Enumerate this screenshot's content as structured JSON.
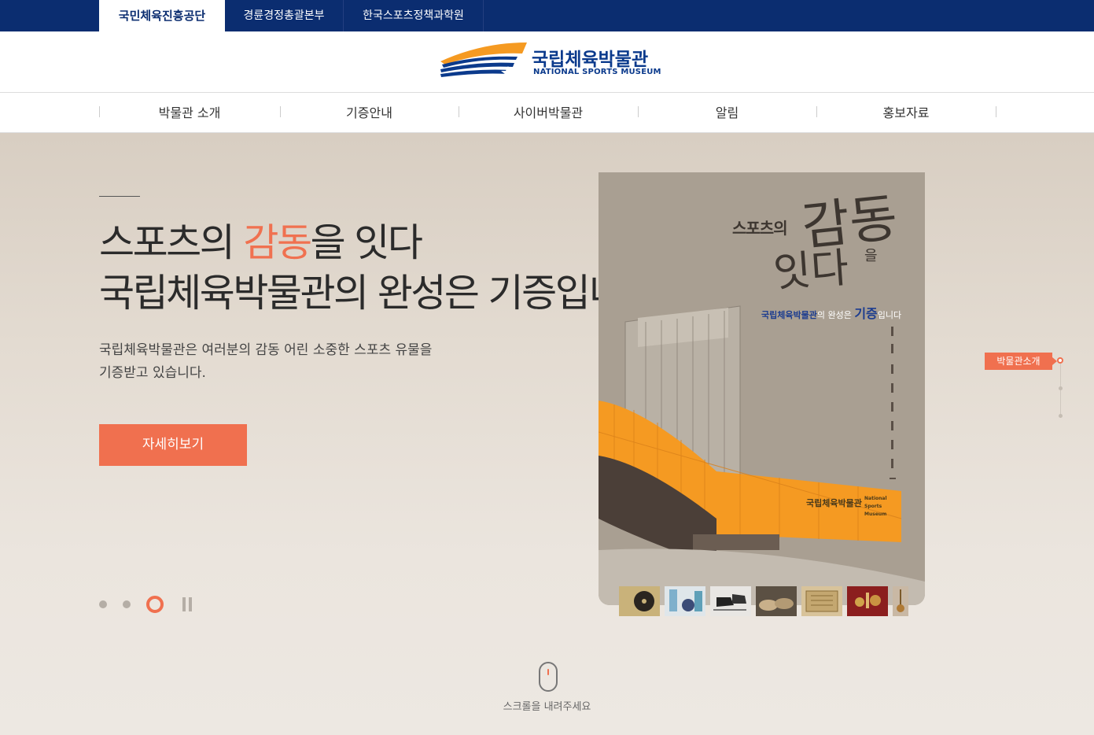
{
  "top_tabs": [
    {
      "label": "국민체육진흥공단",
      "active": true
    },
    {
      "label": "경륜경정총괄본부",
      "active": false
    },
    {
      "label": "한국스포츠정책과학원",
      "active": false
    }
  ],
  "logo": {
    "korean": "국립체육박물관",
    "english": "NATIONAL SPORTS MUSEUM"
  },
  "nav": [
    "박물관 소개",
    "기증안내",
    "사이버박물관",
    "알림",
    "홍보자료"
  ],
  "hero": {
    "title_line1_a": "스포츠의 ",
    "title_line1_highlight": "감동",
    "title_line1_b": "을 잇다",
    "title_line2": "국립체육박물관의 완성은 기증입니다.",
    "desc_line1": "국립체육박물관은 여러분의 감동 어린 소중한 스포츠 유물을",
    "desc_line2": "기증받고 있습니다.",
    "button": "자세히보기"
  },
  "poster": {
    "t1": "스포츠의",
    "t2": "감동",
    "t3": "을",
    "t4": "잇다",
    "sub_a": "국립체육박물관",
    "sub_b": "의 완성은 ",
    "sub_big": "기증",
    "sub_c": "입니다",
    "building_name": "국립체육박물관",
    "building_en": "National Sports Museum"
  },
  "slider": {
    "active_index": 2,
    "count": 3
  },
  "side": {
    "label": "박물관소개"
  },
  "scroll": {
    "text": "스크롤을 내려주세요"
  },
  "colors": {
    "navy": "#0b2d70",
    "accent": "#f0704f",
    "orange": "#f59a22"
  }
}
